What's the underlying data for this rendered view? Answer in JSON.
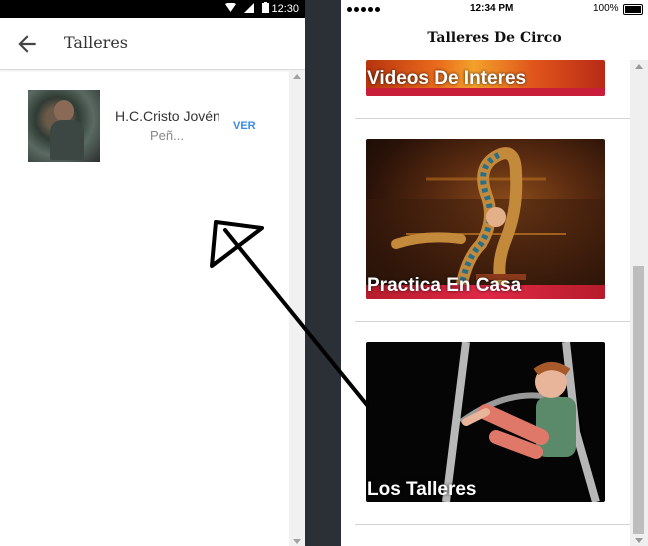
{
  "android": {
    "status_time": "12:30",
    "app_title": "Talleres",
    "rows": [
      {
        "name": "H.C.Cristo Jovén",
        "subtitle": "Peñ...",
        "action": "VER"
      }
    ]
  },
  "ios": {
    "status_time": "12:34 PM",
    "battery": "100%",
    "nav_title": "Talleres De Circo",
    "cards": [
      {
        "label": "Videos De Interes"
      },
      {
        "label": "Practica En Casa"
      },
      {
        "label": "Los Talleres"
      }
    ]
  },
  "colors": {
    "link_blue": "#3b8be9",
    "card_red": "#c91e3a"
  }
}
